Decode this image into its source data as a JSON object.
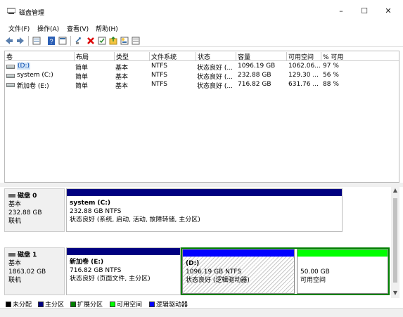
{
  "window": {
    "title": "磁盘管理",
    "minimize": "–",
    "maximize": "☐",
    "close": "✕"
  },
  "menu": [
    "文件(F)",
    "操作(A)",
    "查看(V)",
    "帮助(H)"
  ],
  "toolbar_icons": [
    "back-icon",
    "forward-icon",
    "list-view-icon",
    "help-icon",
    "properties-icon",
    "connect-icon",
    "delete-icon",
    "check-icon",
    "folder-icon",
    "wizard-icon"
  ],
  "columns": [
    "卷",
    "布局",
    "类型",
    "文件系统",
    "状态",
    "容量",
    "可用空间",
    "% 可用"
  ],
  "volumes": [
    {
      "name": "(D:)",
      "layout": "简单",
      "type": "基本",
      "fs": "NTFS",
      "status": "状态良好 (...",
      "capacity": "1096.19 GB",
      "free": "1062.06...",
      "pct": "97 %"
    },
    {
      "name": "system (C:)",
      "layout": "简单",
      "type": "基本",
      "fs": "NTFS",
      "status": "状态良好 (...",
      "capacity": "232.88 GB",
      "free": "129.30 ...",
      "pct": "56 %"
    },
    {
      "name": "新加卷 (E:)",
      "layout": "简单",
      "type": "基本",
      "fs": "NTFS",
      "status": "状态良好 (...",
      "capacity": "716.82 GB",
      "free": "631.76 ...",
      "pct": "88 %"
    }
  ],
  "disks": [
    {
      "title": "磁盘 0",
      "type": "基本",
      "size": "232.88 GB",
      "state": "联机",
      "partitions": [
        {
          "name": "system  (C:)",
          "size": "232.88 GB NTFS",
          "status": "状态良好 (系统, 启动, 活动, 故障转储, 主分区)"
        }
      ]
    },
    {
      "title": "磁盘 1",
      "type": "基本",
      "size": "1863.02 GB",
      "state": "联机",
      "partitions": [
        {
          "name": "新加卷  (E:)",
          "size": "716.82 GB NTFS",
          "status": "状态良好 (页面文件, 主分区)"
        },
        {
          "name": "(D:)",
          "size": "1096.19 GB NTFS",
          "status": "状态良好 (逻辑驱动器)"
        },
        {
          "name": "",
          "size": "50.00 GB",
          "status": "可用空间"
        }
      ]
    }
  ],
  "legend": [
    {
      "label": "未分配",
      "color": "#000000"
    },
    {
      "label": "主分区",
      "color": "#000080"
    },
    {
      "label": "扩展分区",
      "color": "#008000"
    },
    {
      "label": "可用空间",
      "color": "#00ff00"
    },
    {
      "label": "逻辑驱动器",
      "color": "#0000ff"
    }
  ],
  "colors": {
    "primary_partition": "#000080",
    "logical_drive": "#0000ff",
    "extended_partition": "#008000",
    "free_space": "#00ff00"
  }
}
